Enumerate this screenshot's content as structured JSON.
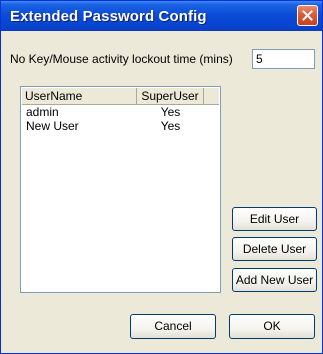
{
  "window": {
    "title": "Extended Password Config"
  },
  "lockout": {
    "label": "No Key/Mouse activity lockout time (mins)",
    "value": "5"
  },
  "users_table": {
    "columns": [
      "UserName",
      "SuperUser"
    ],
    "rows": [
      {
        "username": "admin",
        "superuser": "Yes"
      },
      {
        "username": "New User",
        "superuser": "Yes"
      }
    ]
  },
  "buttons": {
    "edit_user": "Edit User",
    "delete_user": "Delete User",
    "add_new_user": "Add New User",
    "cancel": "Cancel",
    "ok": "OK"
  },
  "colors": {
    "titlebar": "#0a4ad6",
    "window_bg": "#ece9d8",
    "close_button": "#dc5b36"
  },
  "icons": {
    "close": "close-icon"
  }
}
